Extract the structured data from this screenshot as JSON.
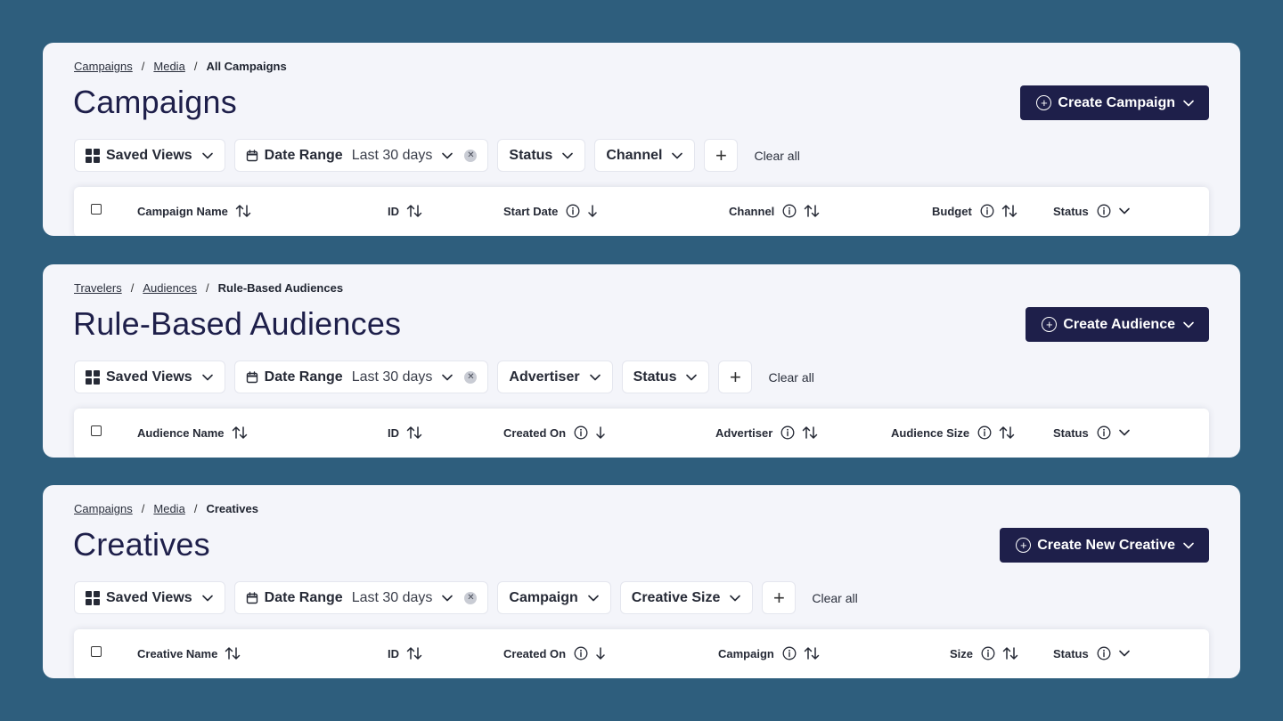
{
  "panels": [
    {
      "breadcrumb": [
        "Campaigns",
        "Media",
        "All Campaigns"
      ],
      "title": "Campaigns",
      "create_label": "Create Campaign",
      "filters": {
        "saved_views": "Saved Views",
        "date_range_label": "Date Range",
        "date_range_value": "Last 30 days",
        "extra": [
          "Status",
          "Channel"
        ],
        "clear_all": "Clear all"
      },
      "columns": [
        "Campaign Name",
        "ID",
        "Start Date",
        "Channel",
        "Budget",
        "Status"
      ]
    },
    {
      "breadcrumb": [
        "Travelers",
        "Audiences",
        "Rule-Based Audiences"
      ],
      "title": "Rule-Based Audiences",
      "create_label": "Create Audience",
      "filters": {
        "saved_views": "Saved Views",
        "date_range_label": "Date Range",
        "date_range_value": "Last 30 days",
        "extra": [
          "Advertiser",
          "Status"
        ],
        "clear_all": "Clear all"
      },
      "columns": [
        "Audience Name",
        "ID",
        "Created On",
        "Advertiser",
        "Audience Size",
        "Status"
      ]
    },
    {
      "breadcrumb": [
        "Campaigns",
        "Media",
        "Creatives"
      ],
      "title": "Creatives",
      "create_label": "Create New Creative",
      "filters": {
        "saved_views": "Saved Views",
        "date_range_label": "Date Range",
        "date_range_value": "Last 30 days",
        "extra": [
          "Campaign",
          "Creative Size"
        ],
        "clear_all": "Clear all"
      },
      "columns": [
        "Creative Name",
        "ID",
        "Created On",
        "Campaign",
        "Size",
        "Status"
      ]
    }
  ],
  "colors": {
    "background": "#2e5e7d",
    "card": "#f4f5fa",
    "primary_button": "#1e1f4a",
    "title": "#1e1f4a"
  }
}
